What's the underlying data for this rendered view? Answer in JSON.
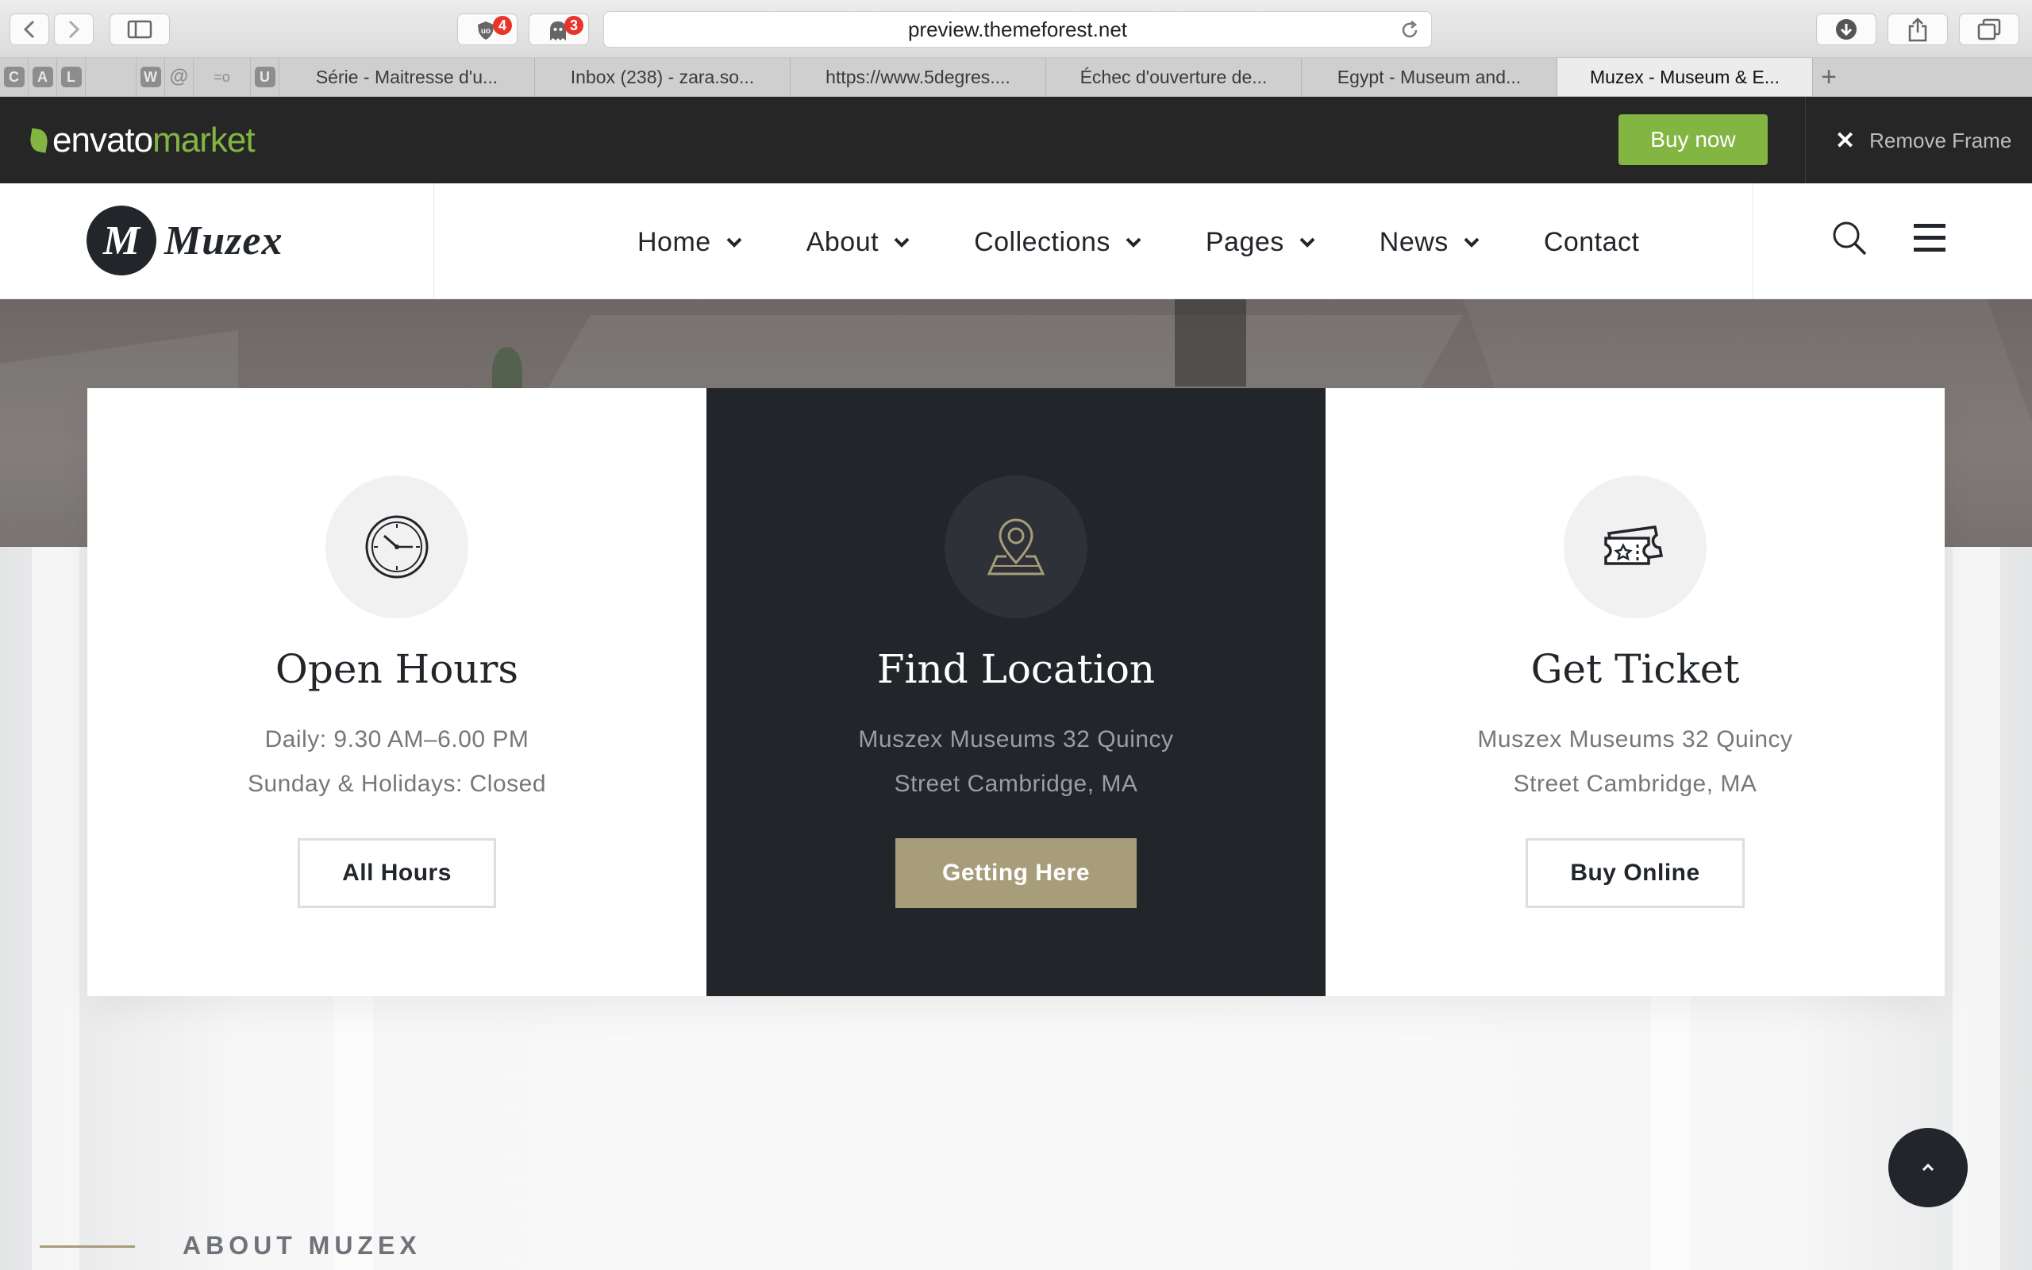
{
  "browser": {
    "url": "preview.themeforest.net",
    "extensions": [
      {
        "name": "ublock-icon",
        "badge": "4"
      },
      {
        "name": "ghostery-icon",
        "badge": "3"
      }
    ],
    "favorites": [
      "C",
      "A",
      "L",
      "W",
      "@",
      "=o",
      "U"
    ],
    "tabs": [
      {
        "label": "Série - Maitresse d'u...",
        "active": false
      },
      {
        "label": "Inbox (238) - zara.so...",
        "active": false
      },
      {
        "label": "https://www.5degres....",
        "active": false
      },
      {
        "label": "Échec d'ouverture de...",
        "active": false
      },
      {
        "label": "Egypt - Museum and...",
        "active": false
      },
      {
        "label": "Muzex - Museum & E...",
        "active": true
      }
    ]
  },
  "envato": {
    "logo_part1": "envato",
    "logo_part2": "market",
    "buy_now": "Buy now",
    "remove_frame": "Remove Frame",
    "brand_color": "#82b541"
  },
  "site": {
    "brand_mark": "M",
    "brand_name": "Muzex",
    "nav": [
      {
        "label": "Home",
        "has_dropdown": true
      },
      {
        "label": "About",
        "has_dropdown": true
      },
      {
        "label": "Collections",
        "has_dropdown": true
      },
      {
        "label": "Pages",
        "has_dropdown": true
      },
      {
        "label": "News",
        "has_dropdown": true
      },
      {
        "label": "Contact",
        "has_dropdown": false
      }
    ],
    "accent_color": "#a79d7b",
    "dark_color": "#22262b"
  },
  "cards": [
    {
      "icon": "clock-icon",
      "title": "Open Hours",
      "line1": "Daily: 9.30 AM–6.00 PM",
      "line2": "Sunday & Holidays: Closed",
      "button": "All Hours"
    },
    {
      "icon": "map-pin-icon",
      "title": "Find Location",
      "line1": "Muszex Museums 32 Quincy",
      "line2": "Street Cambridge, MA",
      "button": "Getting Here"
    },
    {
      "icon": "ticket-icon",
      "title": "Get Ticket",
      "line1": "Muszex Museums 32 Quincy",
      "line2": "Street Cambridge, MA",
      "button": "Buy Online"
    }
  ],
  "about": {
    "label": "ABOUT MUZEX"
  }
}
